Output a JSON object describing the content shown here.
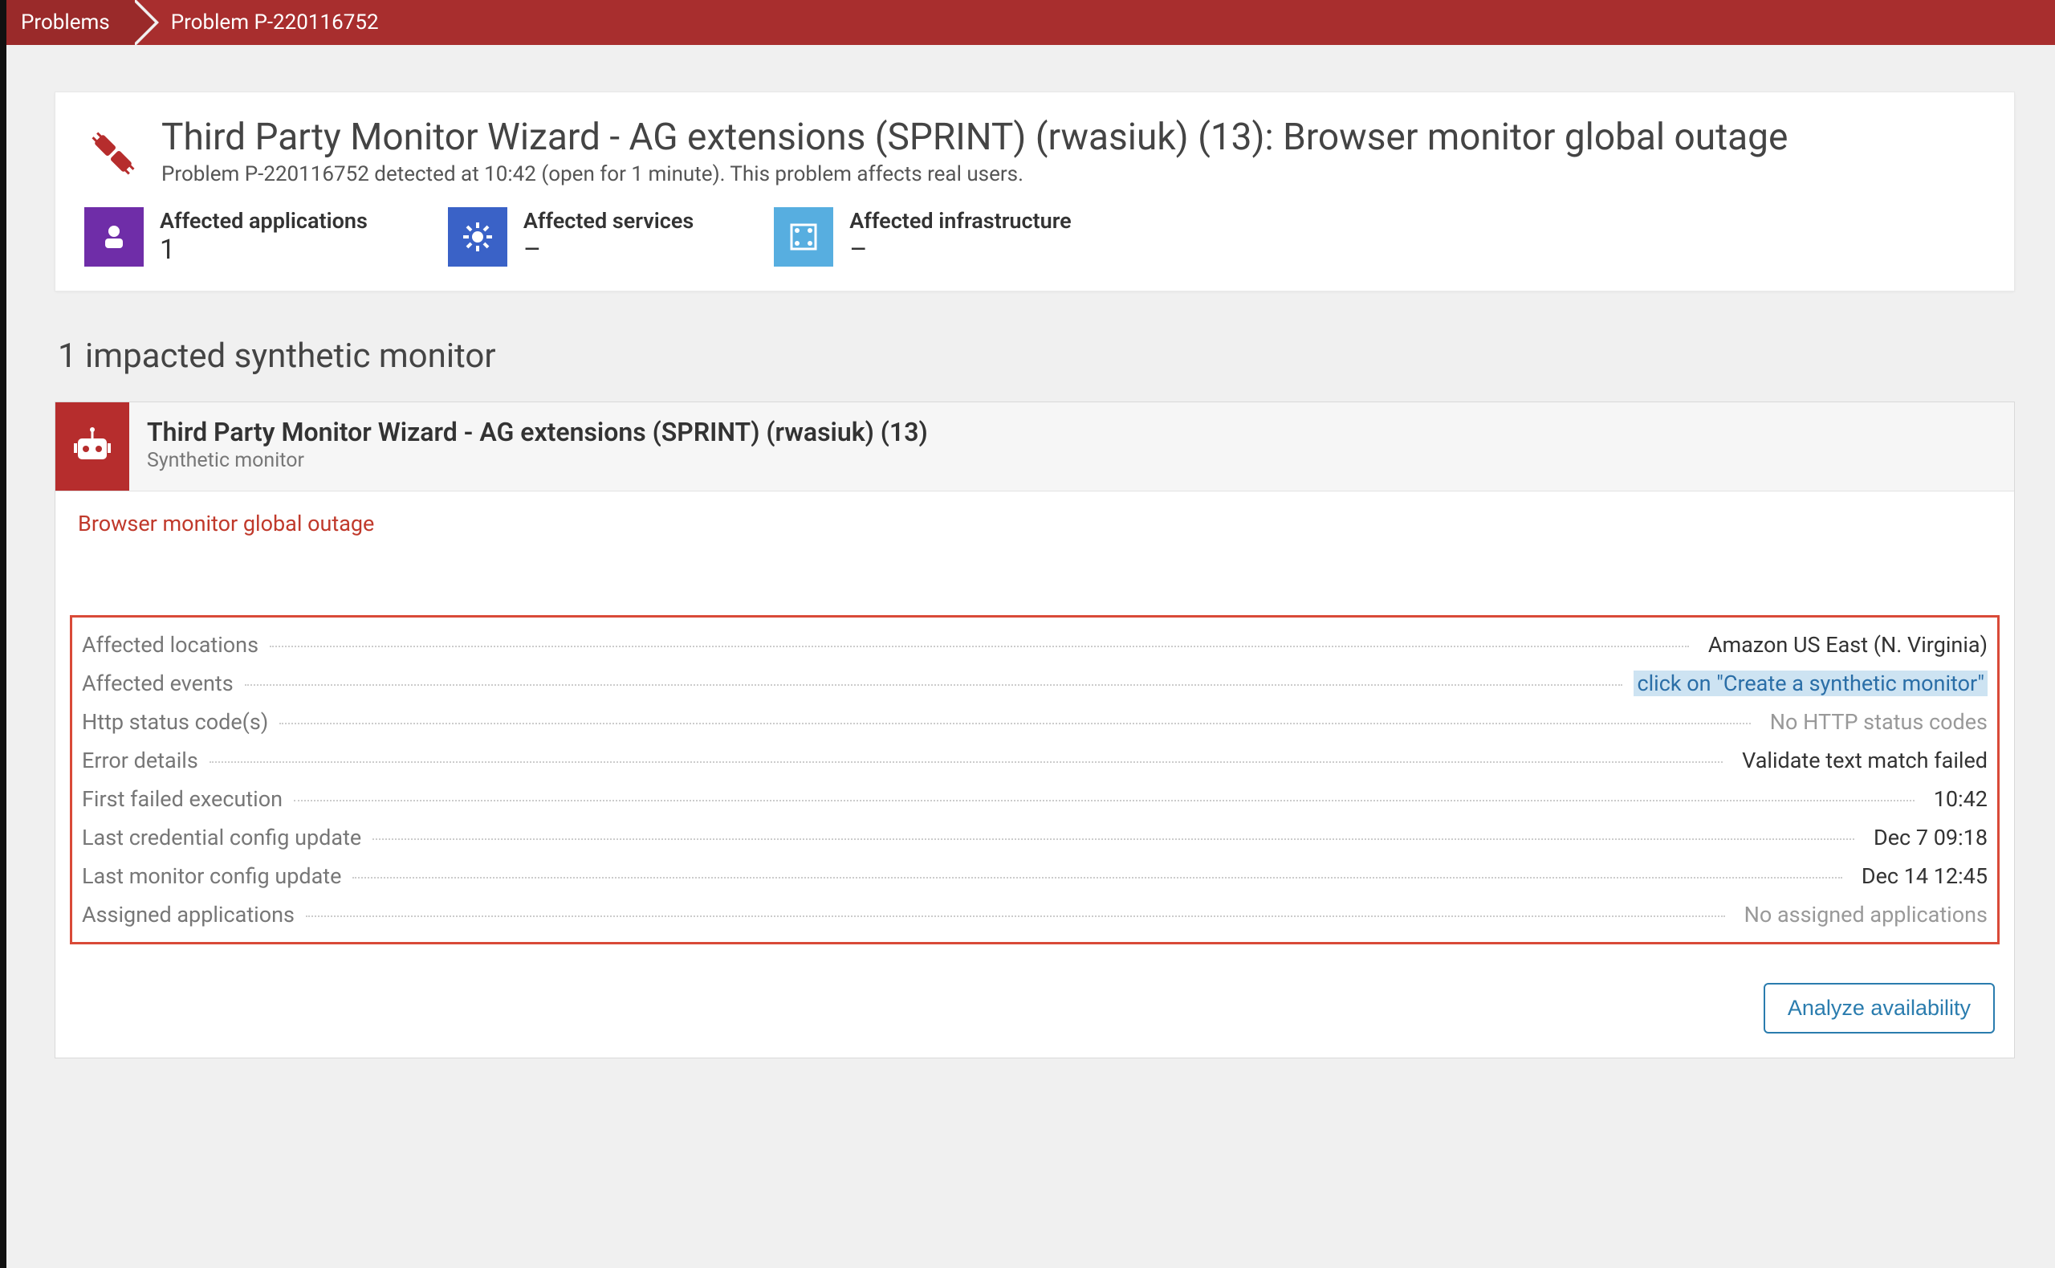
{
  "breadcrumb": {
    "root": "Problems",
    "current": "Problem P-220116752"
  },
  "summary": {
    "title": "Third Party Monitor Wizard - AG extensions (SPRINT) (rwasiuk) (13): Browser monitor global outage",
    "subtitle": "Problem P-220116752 detected at 10:42 (open for 1 minute). This problem affects real users.",
    "tiles": {
      "apps": {
        "label": "Affected applications",
        "value": "1"
      },
      "svc": {
        "label": "Affected services",
        "value": "–"
      },
      "infra": {
        "label": "Affected infrastructure",
        "value": "–"
      }
    }
  },
  "section_title": "1 impacted synthetic monitor",
  "monitor": {
    "title": "Third Party Monitor Wizard - AG extensions (SPRINT) (rwasiuk) (13)",
    "type": "Synthetic monitor",
    "outage": "Browser monitor global outage",
    "details": [
      {
        "label": "Affected locations",
        "value": "Amazon US East (N. Virginia)",
        "style": "normal"
      },
      {
        "label": "Affected events",
        "value": "click on \"Create a synthetic monitor\"",
        "style": "highlight"
      },
      {
        "label": "Http status code(s)",
        "value": "No HTTP status codes",
        "style": "muted"
      },
      {
        "label": "Error details",
        "value": "Validate text match failed",
        "style": "normal"
      },
      {
        "label": "First failed execution",
        "value": "10:42",
        "style": "normal"
      },
      {
        "label": "Last credential config update",
        "value": "Dec 7 09:18",
        "style": "normal"
      },
      {
        "label": "Last monitor config update",
        "value": "Dec 14 12:45",
        "style": "normal"
      },
      {
        "label": "Assigned applications",
        "value": "No assigned applications",
        "style": "muted"
      }
    ],
    "action": "Analyze availability"
  },
  "colors": {
    "brand_red": "#a82e2e",
    "alert_red": "#c0392b",
    "purple": "#6f2da8",
    "blue": "#3a62c7",
    "lightblue": "#57aee0",
    "link_blue": "#2a7cae"
  }
}
